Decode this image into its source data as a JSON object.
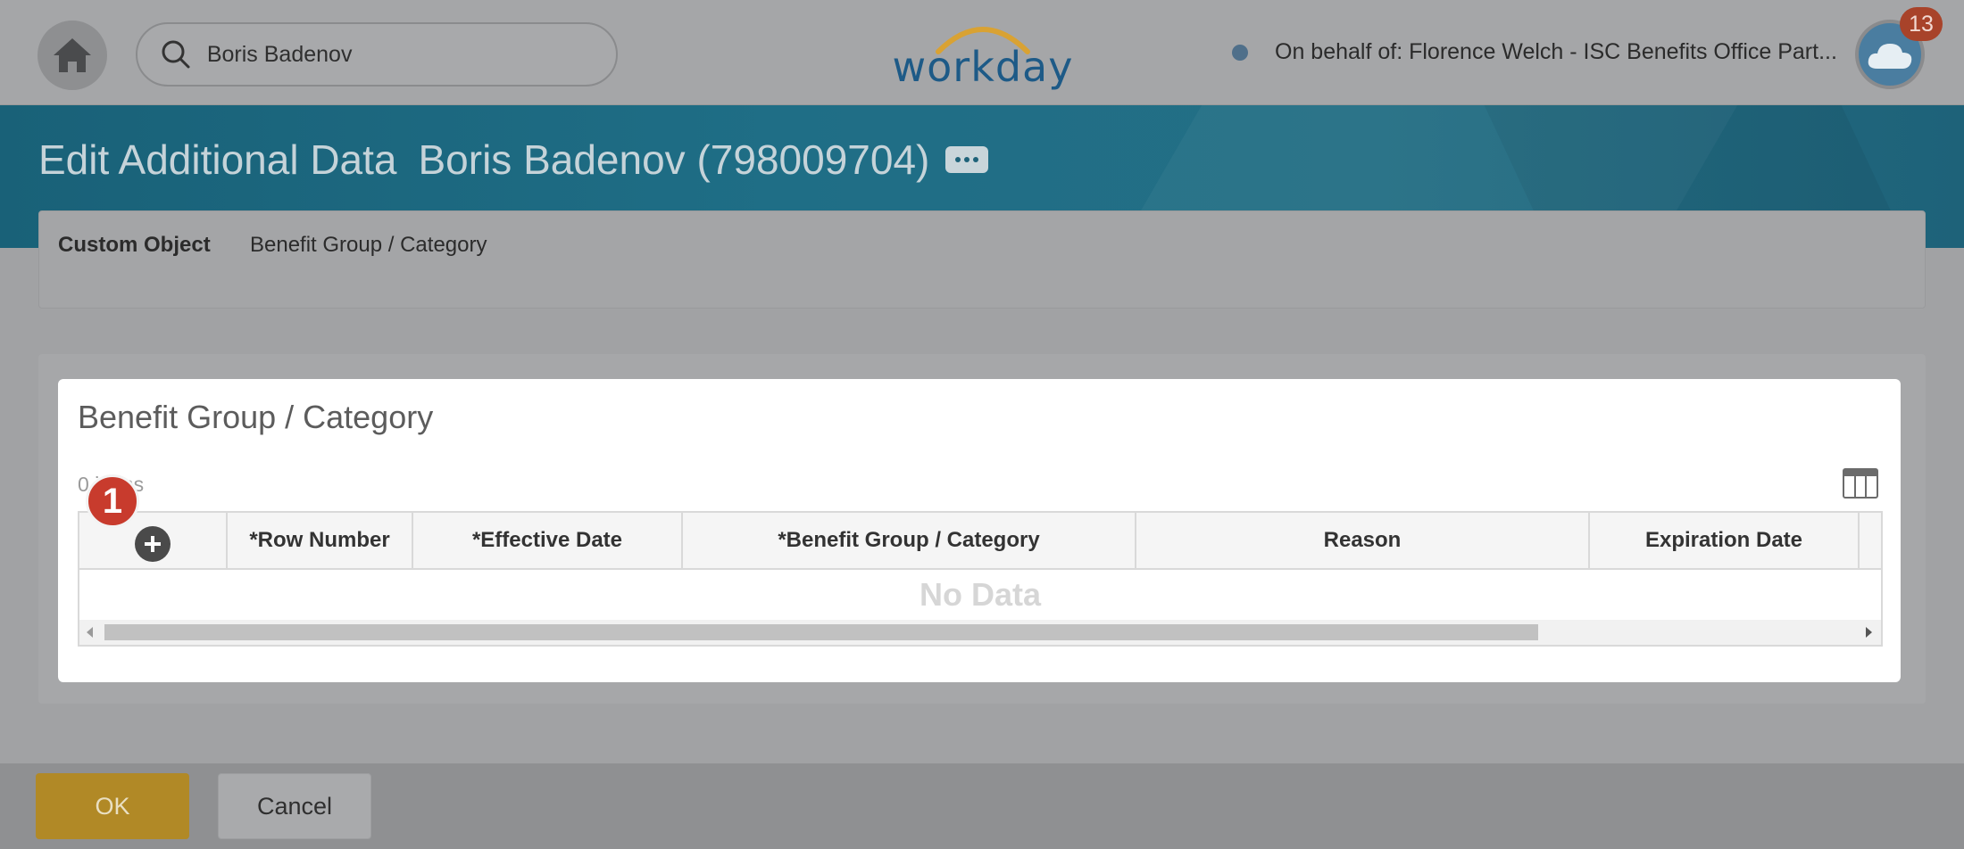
{
  "header": {
    "search_value": "Boris Badenov",
    "logo_text": "workday",
    "on_behalf": "On behalf of: Florence Welch - ISC Benefits Office Part...",
    "notification_count": "13",
    "icons": [
      "home-icon",
      "search-icon",
      "cloud-profile-icon"
    ]
  },
  "page": {
    "title": "Edit Additional Data",
    "subject": "Boris Badenov (798009704)"
  },
  "custom_object": {
    "label": "Custom Object",
    "value": "Benefit Group / Category"
  },
  "grid": {
    "title": "Benefit Group / Category",
    "item_count": "0 items",
    "columns": [
      "*Row Number",
      "*Effective Date",
      "*Benefit Group / Category",
      "Reason",
      "Expiration Date"
    ],
    "empty_text": "No Data"
  },
  "step_marker": "1",
  "footer": {
    "ok_label": "OK",
    "cancel_label": "Cancel"
  },
  "colors": {
    "banner": "#1f6e86",
    "ok_button": "#b18926",
    "badge": "#a8432a",
    "step_marker": "#c83b2d",
    "logo_blue": "#1d5a87",
    "logo_arc": "#d9a233"
  }
}
